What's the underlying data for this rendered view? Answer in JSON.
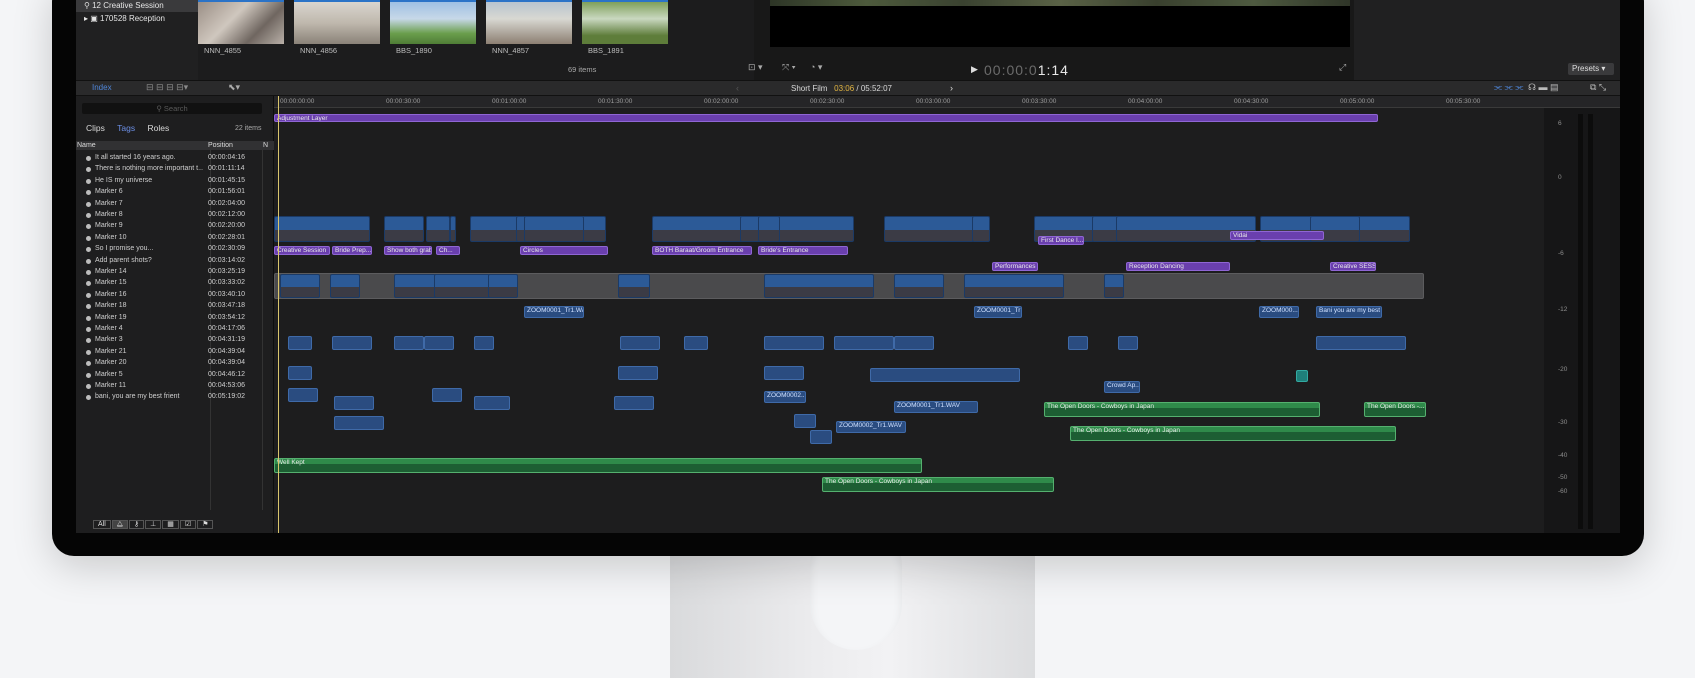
{
  "library": {
    "items": [
      {
        "label": "12 Creative Session",
        "selected": true
      },
      {
        "label": "170528 Reception",
        "selected": false
      }
    ]
  },
  "browser": {
    "thumbnails": [
      "NNN_4855",
      "NNN_4856",
      "BBS_1890",
      "NNN_4857",
      "BBS_1891"
    ],
    "items_count": "69 items"
  },
  "viewer": {
    "timecode_dim": "00:00:0",
    "timecode_lit": "1:14",
    "presets_label": "Presets"
  },
  "toolbar": {
    "index_label": "Index",
    "project_name": "Short Film",
    "project_position": "03:06",
    "project_duration": "/ 05:52:07"
  },
  "index": {
    "search_placeholder": "Search",
    "tabs": [
      {
        "label": "Clips",
        "active": false
      },
      {
        "label": "Tags",
        "active": true
      },
      {
        "label": "Roles",
        "active": false
      }
    ],
    "count": "22 items",
    "col_name": "Name",
    "col_position": "Position",
    "col_n": "N",
    "markers": [
      {
        "name": "It all started 16 years ago.",
        "position": "00:00:04:16"
      },
      {
        "name": "There is nothing more important t...",
        "position": "00:01:11:14"
      },
      {
        "name": "He IS my universe",
        "position": "00:01:45:15"
      },
      {
        "name": "Marker 6",
        "position": "00:01:56:01"
      },
      {
        "name": "Marker 7",
        "position": "00:02:04:00"
      },
      {
        "name": "Marker 8",
        "position": "00:02:12:00"
      },
      {
        "name": "Marker 9",
        "position": "00:02:20:00"
      },
      {
        "name": "Marker 10",
        "position": "00:02:28:01"
      },
      {
        "name": "So I promise you...",
        "position": "00:02:30:09"
      },
      {
        "name": "Add parent shots?",
        "position": "00:03:14:02"
      },
      {
        "name": "Marker 14",
        "position": "00:03:25:19"
      },
      {
        "name": "Marker 15",
        "position": "00:03:33:02"
      },
      {
        "name": "Marker 16",
        "position": "00:03:40:10"
      },
      {
        "name": "Marker 18",
        "position": "00:03:47:18"
      },
      {
        "name": "Marker 19",
        "position": "00:03:54:12"
      },
      {
        "name": "Marker 4",
        "position": "00:04:17:06"
      },
      {
        "name": "Marker 3",
        "position": "00:04:31:19"
      },
      {
        "name": "Marker 21",
        "position": "00:04:39:04"
      },
      {
        "name": "Marker 20",
        "position": "00:04:39:04"
      },
      {
        "name": "Marker 5",
        "position": "00:04:46:12"
      },
      {
        "name": "Marker 11",
        "position": "00:04:53:06"
      },
      {
        "name": "bani, you are my best frient",
        "position": "00:05:19:02"
      }
    ],
    "footer_all": "All"
  },
  "timeline": {
    "ruler": [
      "00:00:00:00",
      "00:00:30:00",
      "00:01:00:00",
      "00:01:30:00",
      "00:02:00:00",
      "00:02:30:00",
      "00:03:00:00",
      "00:03:30:00",
      "00:04:00:00",
      "00:04:30:00",
      "00:05:00:00",
      "00:05:30:00"
    ],
    "adjustment_layer": "Adjustment Layer",
    "purple_labels": [
      "Creative Session",
      "Bride Prep...",
      "Circles",
      "BOTH Baraat/Groom Entrance",
      "Bride's Entrance",
      "First Dance I...",
      "Vidai",
      "Performances",
      "Reception Dancing",
      "Creative SESSI...",
      "Show both grab...",
      "Ch..."
    ],
    "blue_labels": [
      "ZOOM0001_Tr1.WAV",
      "ZOOM0001_Tr1...",
      "ZOOM000...",
      "Bani you are my best f...",
      "ZOOM0001_Tr1.WAV",
      "ZOOM0002_Tr1.WAV",
      "ZOOM0002...",
      "Crowd Ap..."
    ],
    "green_labels": [
      "Well Kept",
      "The Open Doors - Cowboys in Japan",
      "The Open Doors - Cowboys in Japan",
      "The Open Doors - Cowboys in Japan",
      "The Open Doors -..."
    ],
    "meter_labels": [
      "6",
      "0",
      "-6",
      "-12",
      "-20",
      "-30",
      "-40",
      "-50",
      "-60"
    ]
  },
  "colors": {
    "accent": "#4f86d9",
    "clip_blue": "#2c5a97",
    "purple": "#6a3fae",
    "green": "#2f8a4a",
    "playhead": "#d9c56c"
  }
}
